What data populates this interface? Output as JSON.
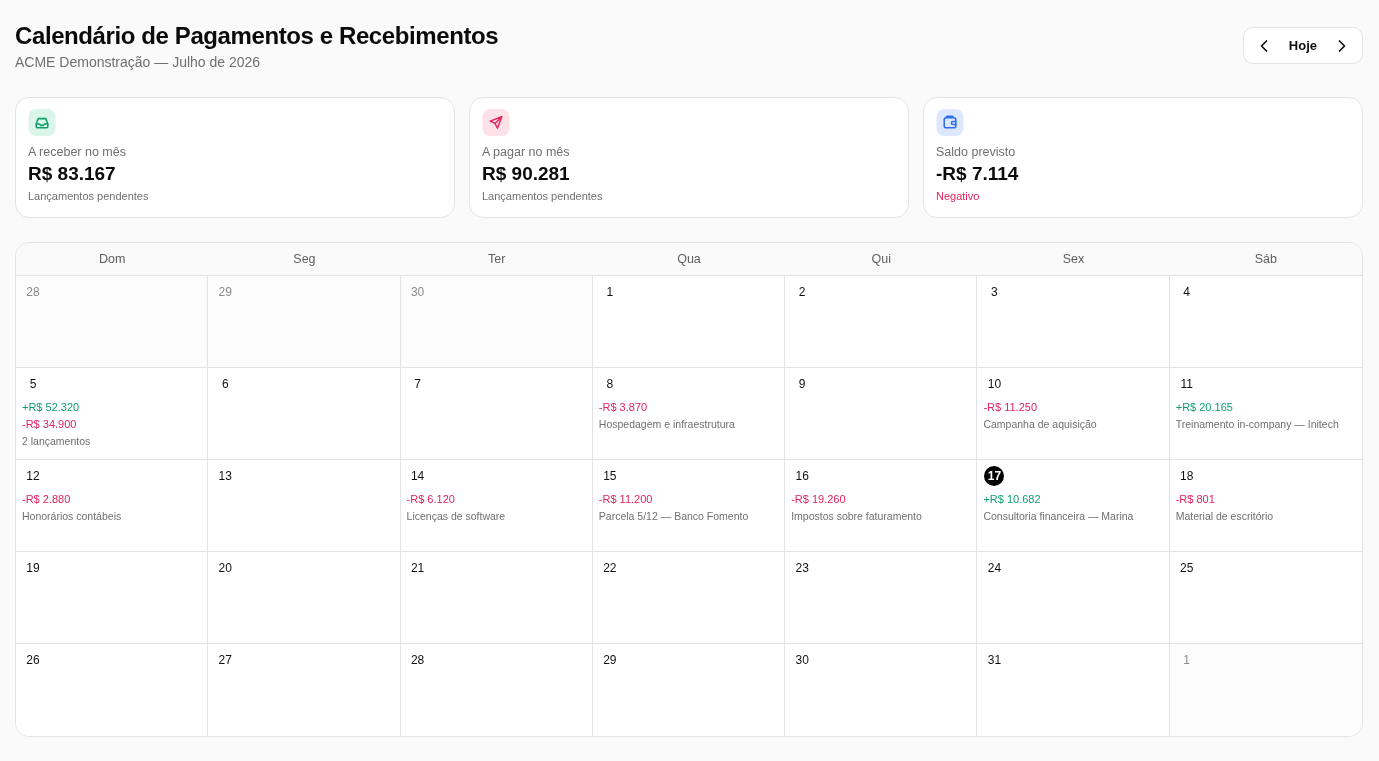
{
  "header": {
    "title": "Calendário de Pagamentos e Recebimentos",
    "subtitle": "ACME Demonstração — Julho de 2026"
  },
  "navigation": {
    "today_label": "Hoje"
  },
  "summary_cards": [
    {
      "kind": "receivable",
      "label": "A receber no mês",
      "value": "R$ 83.167",
      "note": "Lançamentos pendentes",
      "negative": false
    },
    {
      "kind": "payable",
      "label": "A pagar no mês",
      "value": "R$ 90.281",
      "note": "Lançamentos pendentes",
      "negative": false
    },
    {
      "kind": "balance",
      "label": "Saldo previsto",
      "value": "-R$ 7.114",
      "note": "Negativo",
      "negative": true
    }
  ],
  "calendar": {
    "weekdays": [
      "Dom",
      "Seg",
      "Ter",
      "Qua",
      "Qui",
      "Sex",
      "Sáb"
    ],
    "weeks": [
      {
        "days": [
          {
            "day": "28",
            "outside_month": true,
            "today": false
          },
          {
            "day": "29",
            "outside_month": true,
            "today": false
          },
          {
            "day": "30",
            "outside_month": true,
            "today": false
          },
          {
            "day": "1",
            "outside_month": false,
            "today": false
          },
          {
            "day": "2",
            "outside_month": false,
            "today": false
          },
          {
            "day": "3",
            "outside_month": false,
            "today": false
          },
          {
            "day": "4",
            "outside_month": false,
            "today": false
          }
        ]
      },
      {
        "days": [
          {
            "day": "5",
            "outside_month": false,
            "today": false,
            "amounts": [
              {
                "kind": "income",
                "text": "+R$ 52.320"
              },
              {
                "kind": "expense",
                "text": "-R$ 34.900"
              }
            ],
            "note": "2 lançamentos"
          },
          {
            "day": "6",
            "outside_month": false,
            "today": false
          },
          {
            "day": "7",
            "outside_month": false,
            "today": false
          },
          {
            "day": "8",
            "outside_month": false,
            "today": false,
            "amounts": [
              {
                "kind": "expense",
                "text": "-R$ 3.870"
              }
            ],
            "note": "Hospedagem e infraestrutura"
          },
          {
            "day": "9",
            "outside_month": false,
            "today": false
          },
          {
            "day": "10",
            "outside_month": false,
            "today": false,
            "amounts": [
              {
                "kind": "expense",
                "text": "-R$ 11.250"
              }
            ],
            "note": "Campanha de aquisição"
          },
          {
            "day": "11",
            "outside_month": false,
            "today": false,
            "amounts": [
              {
                "kind": "income",
                "text": "+R$ 20.165"
              }
            ],
            "note": "Treinamento in-company — Initech"
          }
        ]
      },
      {
        "days": [
          {
            "day": "12",
            "outside_month": false,
            "today": false,
            "amounts": [
              {
                "kind": "expense",
                "text": "-R$ 2.880"
              }
            ],
            "note": "Honorários contábeis"
          },
          {
            "day": "13",
            "outside_month": false,
            "today": false
          },
          {
            "day": "14",
            "outside_month": false,
            "today": false,
            "amounts": [
              {
                "kind": "expense",
                "text": "-R$ 6.120"
              }
            ],
            "note": "Licenças de software"
          },
          {
            "day": "15",
            "outside_month": false,
            "today": false,
            "amounts": [
              {
                "kind": "expense",
                "text": "-R$ 11.200"
              }
            ],
            "note": "Parcela 5/12 — Banco Fomento"
          },
          {
            "day": "16",
            "outside_month": false,
            "today": false,
            "amounts": [
              {
                "kind": "expense",
                "text": "-R$ 19.260"
              }
            ],
            "note": "Impostos sobre faturamento"
          },
          {
            "day": "17",
            "outside_month": false,
            "today": true,
            "amounts": [
              {
                "kind": "income",
                "text": "+R$ 10.682"
              }
            ],
            "note": "Consultoria financeira — Marina"
          },
          {
            "day": "18",
            "outside_month": false,
            "today": false,
            "amounts": [
              {
                "kind": "expense",
                "text": "-R$ 801"
              }
            ],
            "note": "Material de escritório"
          }
        ]
      },
      {
        "days": [
          {
            "day": "19",
            "outside_month": false,
            "today": false
          },
          {
            "day": "20",
            "outside_month": false,
            "today": false
          },
          {
            "day": "21",
            "outside_month": false,
            "today": false
          },
          {
            "day": "22",
            "outside_month": false,
            "today": false
          },
          {
            "day": "23",
            "outside_month": false,
            "today": false
          },
          {
            "day": "24",
            "outside_month": false,
            "today": false
          },
          {
            "day": "25",
            "outside_month": false,
            "today": false
          }
        ]
      },
      {
        "days": [
          {
            "day": "26",
            "outside_month": false,
            "today": false
          },
          {
            "day": "27",
            "outside_month": false,
            "today": false
          },
          {
            "day": "28",
            "outside_month": false,
            "today": false
          },
          {
            "day": "29",
            "outside_month": false,
            "today": false
          },
          {
            "day": "30",
            "outside_month": false,
            "today": false
          },
          {
            "day": "31",
            "outside_month": false,
            "today": false
          },
          {
            "day": "1",
            "outside_month": true,
            "today": false
          }
        ]
      }
    ]
  }
}
